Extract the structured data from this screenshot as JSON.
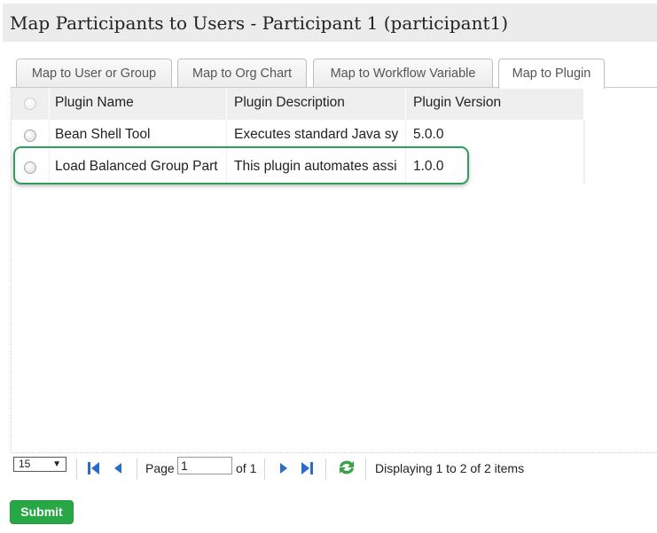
{
  "title": "Map Participants to Users - Participant 1 (participant1)",
  "tabs": [
    {
      "label": "Map to User or Group"
    },
    {
      "label": "Map to Org Chart"
    },
    {
      "label": "Map to Workflow Variable"
    },
    {
      "label": "Map to Plugin",
      "active": true
    }
  ],
  "grid": {
    "columns": [
      "Plugin Name",
      "Plugin Description",
      "Plugin Version"
    ],
    "rows": [
      {
        "name": "Bean Shell Tool",
        "description": "Executes standard Java sy",
        "version": "5.0.0"
      },
      {
        "name": "Load Balanced Group Part",
        "description": "This plugin automates assi",
        "version": "1.0.0"
      }
    ]
  },
  "pager": {
    "page_size": "15",
    "page_label": "Page",
    "page_value": "1",
    "of_label": "of 1",
    "display_text": "Displaying 1 to 2 of 2 items"
  },
  "submit_label": "Submit",
  "colors": {
    "accent": "#28a745",
    "highlight": "#2e9e5a",
    "pager_icon": "#2b6cc4",
    "refresh_icon": "#3aa34a"
  },
  "icons": [
    "first-page-icon",
    "prev-page-icon",
    "next-page-icon",
    "last-page-icon",
    "refresh-icon",
    "radio-icon"
  ]
}
